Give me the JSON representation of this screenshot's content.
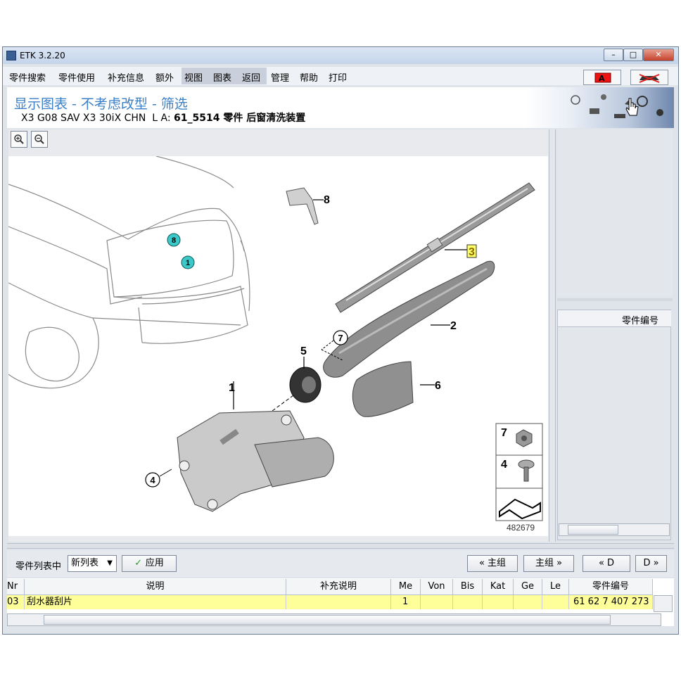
{
  "window": {
    "title": "ETK 3.2.20",
    "minimize": "–",
    "maximize": "□",
    "close": "✕"
  },
  "menu": {
    "items": [
      "零件搜索",
      "零件使用",
      "补充信息",
      "额外",
      "视图",
      "图表",
      "返回",
      "管理",
      "帮助",
      "打印"
    ]
  },
  "header": {
    "title": "显示图表 - 不考虑改型 - 筛选",
    "subtitle_prefix": "X3 G08 SAV X3 30iX CHN  L A: ",
    "subtitle_bold": "61_5514 零件 后窗清洗装置"
  },
  "diagram": {
    "callouts": [
      "8",
      "3",
      "2",
      "5",
      "7",
      "1",
      "6",
      "4"
    ],
    "car_markers": [
      "8",
      "1"
    ],
    "legend": [
      "7",
      "4"
    ],
    "image_number": "482679"
  },
  "right_panel": {
    "column_header": "零件编号"
  },
  "toolbar": {
    "list_label": "零件列表中",
    "list_select": "新列表",
    "apply_label": "应用",
    "prev_group": "« 主组",
    "next_group": "主组 »",
    "prev_d": "« D",
    "next_d": "D »"
  },
  "table": {
    "columns": [
      "Nr",
      "说明",
      "补充说明",
      "Me",
      "Von",
      "Bis",
      "Kat",
      "Ge",
      "Le",
      "零件编号"
    ],
    "rows": [
      {
        "nr": "03",
        "desc": "刮水器刮片",
        "extra": "",
        "me": "1",
        "von": "",
        "bis": "",
        "kat": "",
        "ge": "",
        "le": "",
        "part": "61 62 7 407 273"
      }
    ]
  },
  "colors": {
    "accent": "#3b7fc6",
    "highlight_row": "#ffff99",
    "marker": "#3cc8c8"
  }
}
